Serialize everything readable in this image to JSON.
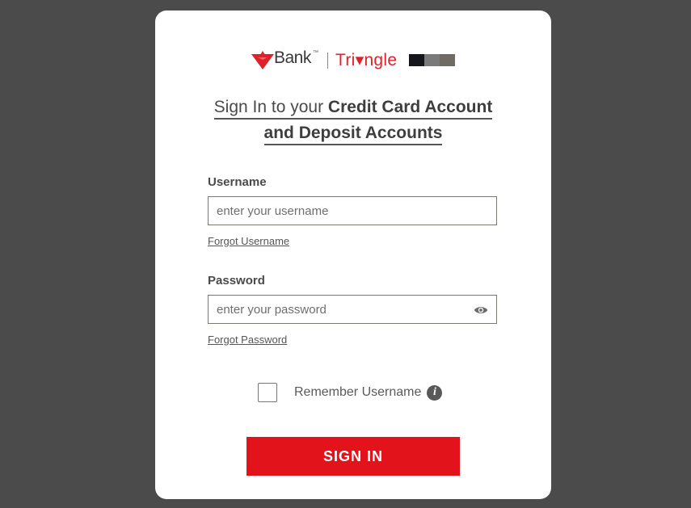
{
  "logo": {
    "bank_text": "Bank",
    "trademark": "™",
    "triangle_text": "Tri▾ngle",
    "brand_red": "#e0202a"
  },
  "heading": {
    "line1_light": "Sign In to your ",
    "line1_bold": "Credit Card Account",
    "line2_bold": "and Deposit Accounts"
  },
  "username": {
    "label": "Username",
    "placeholder": "enter your username",
    "value": "",
    "forgot_link": "Forgot Username"
  },
  "password": {
    "label": "Password",
    "placeholder": "enter your password",
    "value": "",
    "forgot_link": "Forgot Password",
    "toggle_icon": "eye-icon"
  },
  "remember": {
    "label": "Remember Username",
    "checked": false,
    "info_icon": "info-icon",
    "info_glyph": "i"
  },
  "signin_button": {
    "label": "SIGN IN",
    "color": "#e3131b"
  }
}
